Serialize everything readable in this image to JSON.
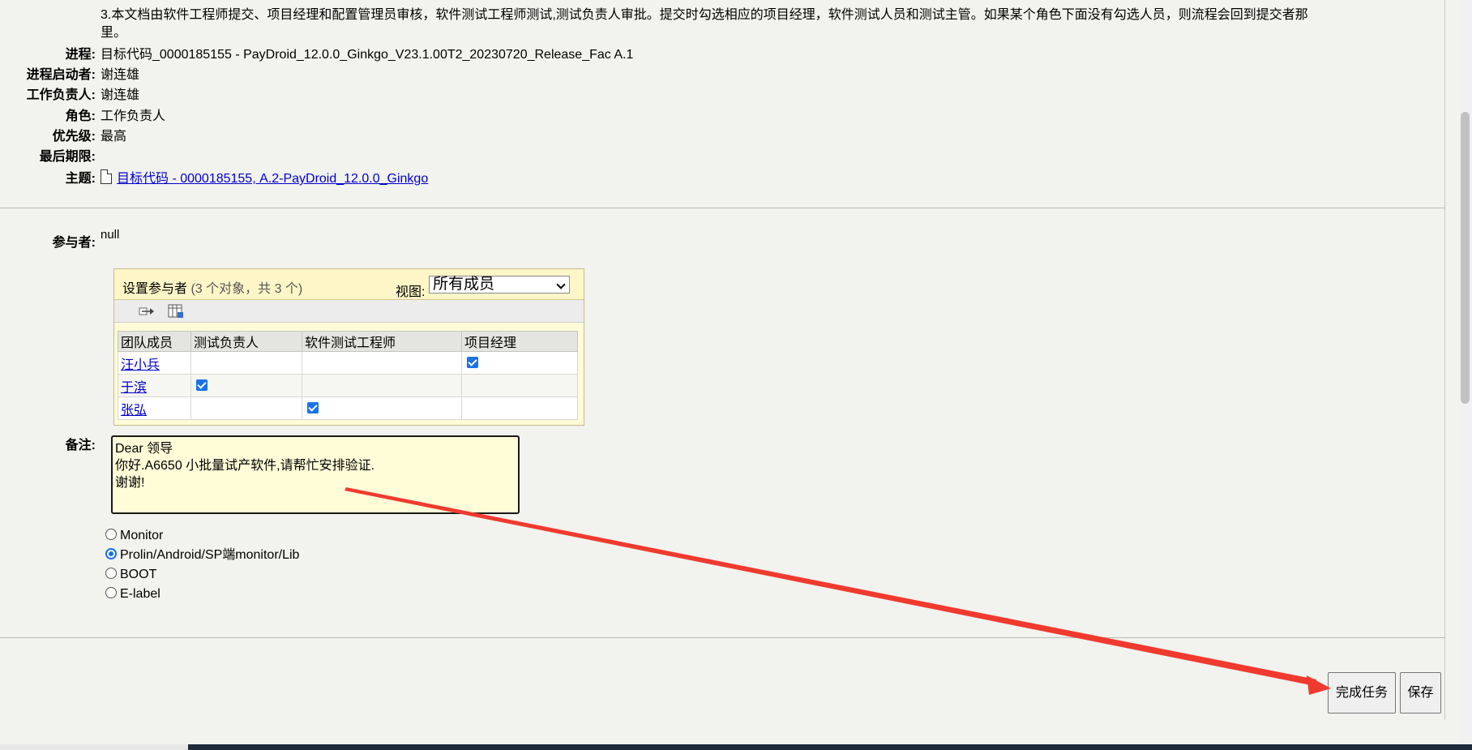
{
  "form": {
    "description": "3.本文档由软件工程师提交、项目经理和配置管理员审核，软件测试工程师测试,测试负责人审批。提交时勾选相应的项目经理，软件测试人员和测试主管。如果某个角色下面没有勾选人员，则流程会回到提交者那里。",
    "fields": {
      "process_label": "进程:",
      "process_value": "目标代码_0000185155 - PayDroid_12.0.0_Ginkgo_V23.1.00T2_20230720_Release_Fac A.1",
      "initiator_label": "进程启动者:",
      "initiator_value": "谢连雄",
      "assignee_label": "工作负责人:",
      "assignee_value": "谢连雄",
      "role_label": "角色:",
      "role_value": "工作负责人",
      "priority_label": "优先级:",
      "priority_value": "最高",
      "deadline_label": "最后期限:",
      "deadline_value": "",
      "subject_label": "主题:",
      "subject_link": "目标代码 - 0000185155, A.2-PayDroid_12.0.0_Ginkgo"
    },
    "participants_label": "参与者:",
    "participants_value": "null"
  },
  "participants_panel": {
    "title": "设置参与者",
    "count": "(3 个对象，共 3 个)",
    "view_label": "视图:",
    "view_selected": "所有成员",
    "icons": [
      "add-participant-icon",
      "table-settings-icon"
    ],
    "columns": [
      "团队成员",
      "测试负责人",
      "软件测试工程师",
      "项目经理"
    ],
    "rows": [
      {
        "member": "汪小兵",
        "test_lead": false,
        "sw_test_engineer": false,
        "project_manager": true
      },
      {
        "member": "于滨",
        "test_lead": true,
        "sw_test_engineer": false,
        "project_manager": false
      },
      {
        "member": "张弘",
        "test_lead": false,
        "sw_test_engineer": true,
        "project_manager": false
      }
    ]
  },
  "notes": {
    "label": "备注:",
    "value": "Dear 领导\n你好.A6650 小批量试产软件,请帮忙安排验证.\n谢谢!"
  },
  "options": {
    "items": [
      "Monitor",
      "Prolin/Android/SP端monitor/Lib",
      "BOOT",
      "E-label"
    ],
    "selected_index": 1
  },
  "buttons": {
    "complete_task": "完成任务",
    "save": "保存"
  },
  "colors": {
    "annotation_arrow": "#f03a2e",
    "link": "#0000cc",
    "panel_bg": "#fffbd6",
    "checkbox": "#1a73e8"
  }
}
